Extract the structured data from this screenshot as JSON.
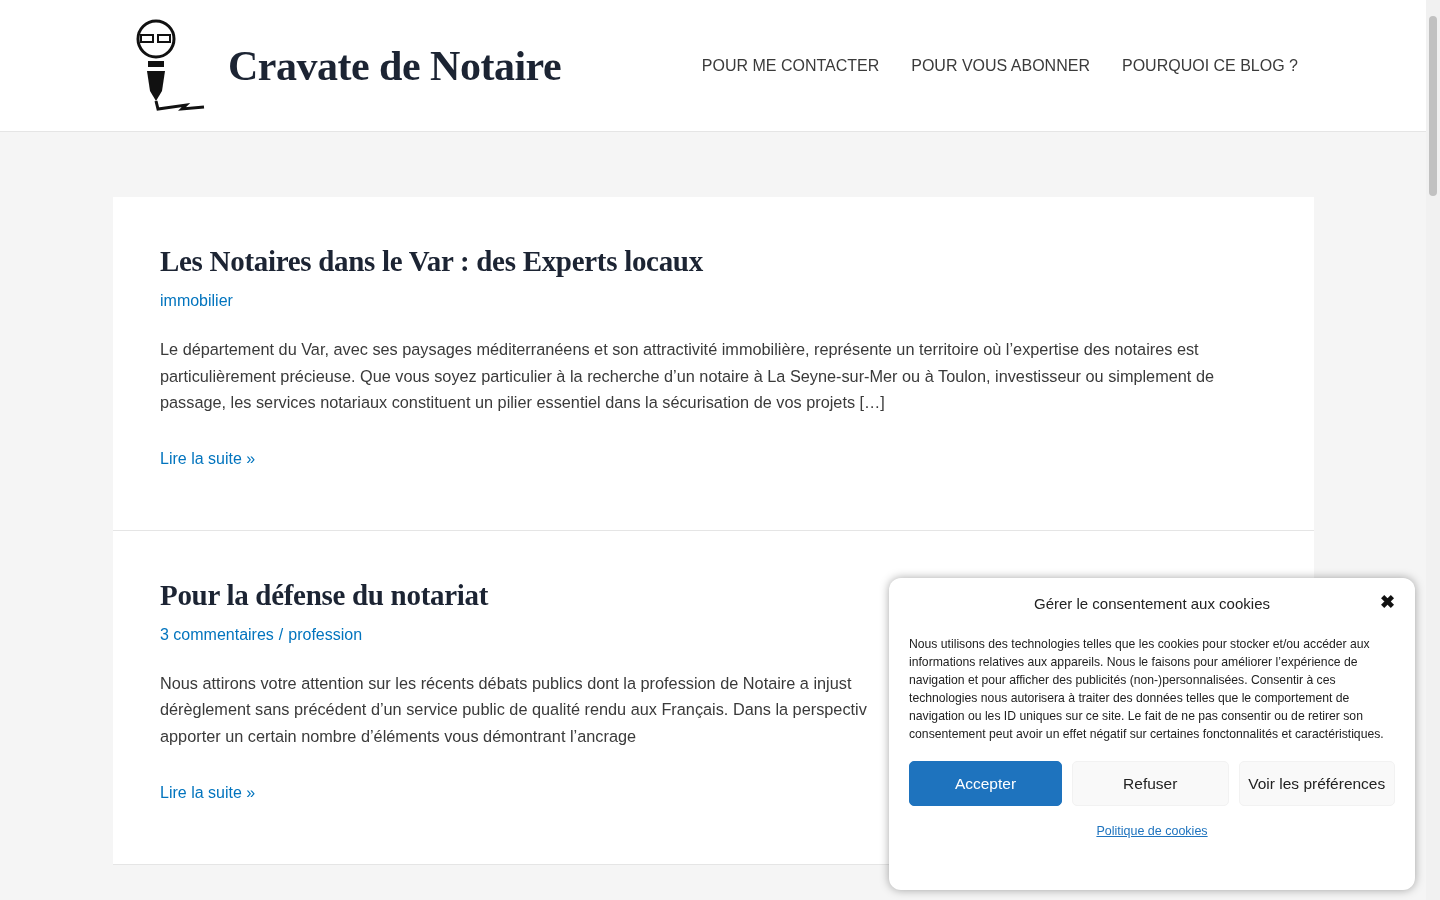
{
  "site": {
    "title": "Cravate de Notaire"
  },
  "nav": [
    {
      "label": "POUR ME CONTACTER"
    },
    {
      "label": "POUR VOUS ABONNER"
    },
    {
      "label": "POURQUOI CE BLOG ?"
    }
  ],
  "posts": [
    {
      "title": "Les Notaires dans le Var : des Experts locaux",
      "meta": [
        {
          "label": "immobilier"
        }
      ],
      "excerpt_lines": [
        "Le département du Var, avec ses paysages méditerranéens et son attractivité immobilière, représente un territoire où l’expertise des notaires est",
        "particulièrement précieuse. Que vous soyez particulier à la recherche d’un notaire à La Seyne-sur-Mer ou à Toulon, investisseur ou simplement de",
        "passage, les services notariaux constituent un pilier essentiel dans la sécurisation de vos projets […]"
      ],
      "read_more": "Lire la suite »"
    },
    {
      "title": "Pour la défense du notariat",
      "meta": [
        {
          "label": "3 commentaires"
        },
        {
          "label": "profession"
        }
      ],
      "meta_separator": "/",
      "excerpt_lines": [
        "Nous attirons votre attention sur les récents débats publics dont la profession de Notaire a injust",
        "dérèglement sans précédent d’un service public de qualité rendu aux Français. Dans la perspectiv",
        "apporter un certain nombre d’éléments vous démontrant l’ancrage"
      ],
      "read_more": "Lire la suite »"
    }
  ],
  "cookie_dialog": {
    "title": "Gérer le consentement aux cookies",
    "close": "✖",
    "body": "Nous utilisons des technologies telles que les cookies pour stocker et/ou accéder aux informations relatives aux appareils. Nous le faisons pour améliorer l’expérience de navigation et pour afficher des publicités (non-)personnalisées. Consentir à ces technologies nous autorisera à traiter des données telles que le comportement de navigation ou les ID uniques sur ce site. Le fait de ne pas consentir ou de retirer son consentement peut avoir un effet négatif sur certaines fonctonnalités et caractéristiques.",
    "buttons": [
      {
        "label": "Accepter",
        "kind": "primary"
      },
      {
        "label": "Refuser",
        "kind": "secondary"
      },
      {
        "label": "Voir les préférences",
        "kind": "secondary"
      }
    ],
    "policy_link": "Politique de cookies"
  }
}
